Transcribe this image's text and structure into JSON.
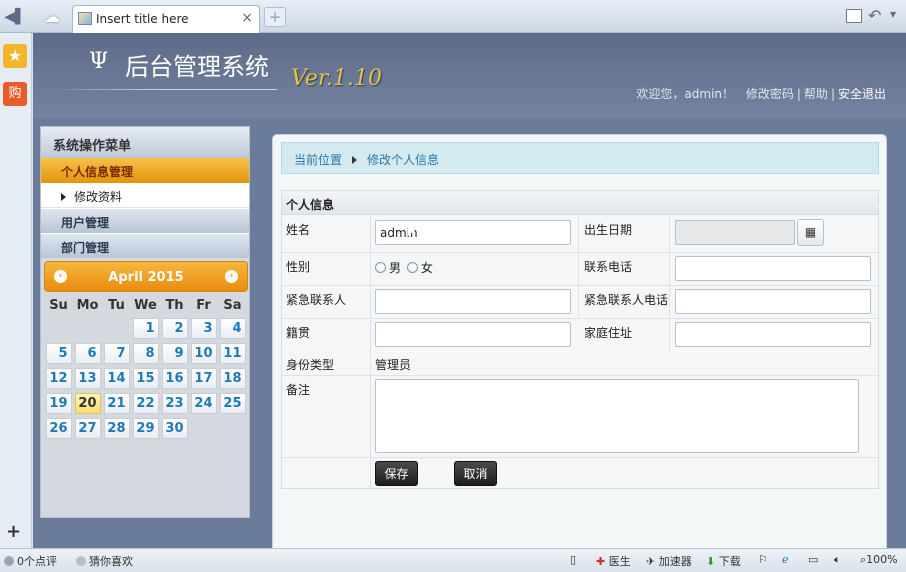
{
  "browser": {
    "tab_title": "Insert title here",
    "tab_close": "×",
    "new_tab": "+"
  },
  "header": {
    "logo_symbol": "Ψ",
    "title": "后台管理系统",
    "version": "Ver.1.10",
    "welcome": "欢迎您，admin！",
    "change_password": "修改密码",
    "help": "帮助",
    "logout": "安全退出"
  },
  "menu": {
    "title": "系统操作菜单",
    "active_section": "个人信息管理",
    "active_sub": "修改资料",
    "items": [
      "用户管理",
      "部门管理"
    ]
  },
  "calendar": {
    "month_label": "April 2015",
    "prev": "‹",
    "next": "›",
    "weekdays": [
      "Su",
      "Mo",
      "Tu",
      "We",
      "Th",
      "Fr",
      "Sa"
    ],
    "days": [
      "",
      "",
      "",
      "1",
      "2",
      "3",
      "4",
      "5",
      "6",
      "7",
      "8",
      "9",
      "10",
      "11",
      "12",
      "13",
      "14",
      "15",
      "16",
      "17",
      "18",
      "19",
      "20",
      "21",
      "22",
      "23",
      "24",
      "25",
      "26",
      "27",
      "28",
      "29",
      "30"
    ],
    "today": "20"
  },
  "breadcrumb": {
    "location": "当前位置",
    "page": "修改个人信息"
  },
  "form": {
    "title": "个人信息",
    "name_label": "姓名",
    "name_value": "admin",
    "birth_label": "出生日期",
    "birth_value": "",
    "gender_label": "性别",
    "gender_male": "男",
    "gender_female": "女",
    "phone_label": "联系电话",
    "emergency_contact_label": "紧急联系人",
    "emergency_phone_label": "紧急联系人电话",
    "native_place_label": "籍贯",
    "address_label": "家庭住址",
    "identity_label": "身份类型",
    "identity_value": "管理员",
    "remark_label": "备注",
    "save_label": "保存",
    "cancel_label": "取消"
  },
  "statusbar": {
    "comments": "0个点评",
    "guess": "猜你喜欢",
    "doctor": "医生",
    "accelerator": "加速器",
    "download": "下载",
    "zoom": "100%"
  }
}
